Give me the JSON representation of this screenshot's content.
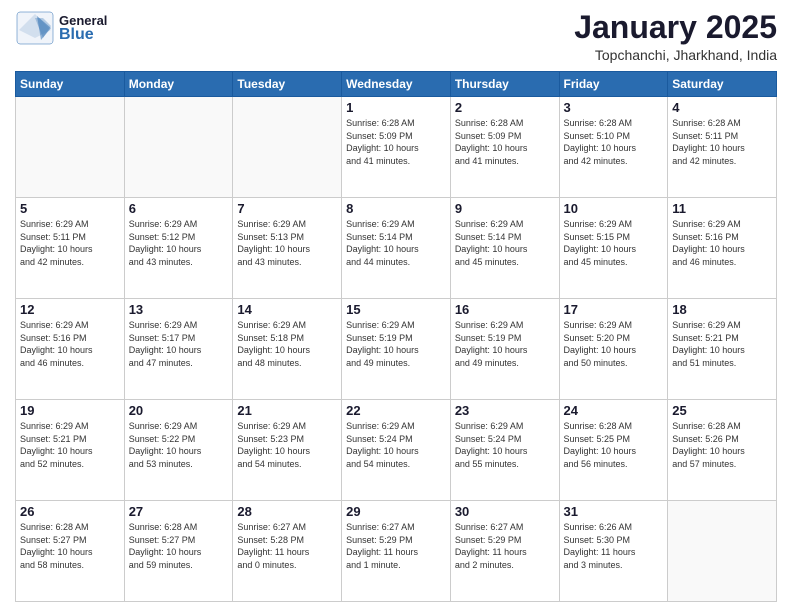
{
  "header": {
    "logo_general": "General",
    "logo_blue": "Blue",
    "month_title": "January 2025",
    "location": "Topchanchi, Jharkhand, India"
  },
  "days_of_week": [
    "Sunday",
    "Monday",
    "Tuesday",
    "Wednesday",
    "Thursday",
    "Friday",
    "Saturday"
  ],
  "weeks": [
    [
      {
        "day": "",
        "info": ""
      },
      {
        "day": "",
        "info": ""
      },
      {
        "day": "",
        "info": ""
      },
      {
        "day": "1",
        "info": "Sunrise: 6:28 AM\nSunset: 5:09 PM\nDaylight: 10 hours\nand 41 minutes."
      },
      {
        "day": "2",
        "info": "Sunrise: 6:28 AM\nSunset: 5:09 PM\nDaylight: 10 hours\nand 41 minutes."
      },
      {
        "day": "3",
        "info": "Sunrise: 6:28 AM\nSunset: 5:10 PM\nDaylight: 10 hours\nand 42 minutes."
      },
      {
        "day": "4",
        "info": "Sunrise: 6:28 AM\nSunset: 5:11 PM\nDaylight: 10 hours\nand 42 minutes."
      }
    ],
    [
      {
        "day": "5",
        "info": "Sunrise: 6:29 AM\nSunset: 5:11 PM\nDaylight: 10 hours\nand 42 minutes."
      },
      {
        "day": "6",
        "info": "Sunrise: 6:29 AM\nSunset: 5:12 PM\nDaylight: 10 hours\nand 43 minutes."
      },
      {
        "day": "7",
        "info": "Sunrise: 6:29 AM\nSunset: 5:13 PM\nDaylight: 10 hours\nand 43 minutes."
      },
      {
        "day": "8",
        "info": "Sunrise: 6:29 AM\nSunset: 5:14 PM\nDaylight: 10 hours\nand 44 minutes."
      },
      {
        "day": "9",
        "info": "Sunrise: 6:29 AM\nSunset: 5:14 PM\nDaylight: 10 hours\nand 45 minutes."
      },
      {
        "day": "10",
        "info": "Sunrise: 6:29 AM\nSunset: 5:15 PM\nDaylight: 10 hours\nand 45 minutes."
      },
      {
        "day": "11",
        "info": "Sunrise: 6:29 AM\nSunset: 5:16 PM\nDaylight: 10 hours\nand 46 minutes."
      }
    ],
    [
      {
        "day": "12",
        "info": "Sunrise: 6:29 AM\nSunset: 5:16 PM\nDaylight: 10 hours\nand 46 minutes."
      },
      {
        "day": "13",
        "info": "Sunrise: 6:29 AM\nSunset: 5:17 PM\nDaylight: 10 hours\nand 47 minutes."
      },
      {
        "day": "14",
        "info": "Sunrise: 6:29 AM\nSunset: 5:18 PM\nDaylight: 10 hours\nand 48 minutes."
      },
      {
        "day": "15",
        "info": "Sunrise: 6:29 AM\nSunset: 5:19 PM\nDaylight: 10 hours\nand 49 minutes."
      },
      {
        "day": "16",
        "info": "Sunrise: 6:29 AM\nSunset: 5:19 PM\nDaylight: 10 hours\nand 49 minutes."
      },
      {
        "day": "17",
        "info": "Sunrise: 6:29 AM\nSunset: 5:20 PM\nDaylight: 10 hours\nand 50 minutes."
      },
      {
        "day": "18",
        "info": "Sunrise: 6:29 AM\nSunset: 5:21 PM\nDaylight: 10 hours\nand 51 minutes."
      }
    ],
    [
      {
        "day": "19",
        "info": "Sunrise: 6:29 AM\nSunset: 5:21 PM\nDaylight: 10 hours\nand 52 minutes."
      },
      {
        "day": "20",
        "info": "Sunrise: 6:29 AM\nSunset: 5:22 PM\nDaylight: 10 hours\nand 53 minutes."
      },
      {
        "day": "21",
        "info": "Sunrise: 6:29 AM\nSunset: 5:23 PM\nDaylight: 10 hours\nand 54 minutes."
      },
      {
        "day": "22",
        "info": "Sunrise: 6:29 AM\nSunset: 5:24 PM\nDaylight: 10 hours\nand 54 minutes."
      },
      {
        "day": "23",
        "info": "Sunrise: 6:29 AM\nSunset: 5:24 PM\nDaylight: 10 hours\nand 55 minutes."
      },
      {
        "day": "24",
        "info": "Sunrise: 6:28 AM\nSunset: 5:25 PM\nDaylight: 10 hours\nand 56 minutes."
      },
      {
        "day": "25",
        "info": "Sunrise: 6:28 AM\nSunset: 5:26 PM\nDaylight: 10 hours\nand 57 minutes."
      }
    ],
    [
      {
        "day": "26",
        "info": "Sunrise: 6:28 AM\nSunset: 5:27 PM\nDaylight: 10 hours\nand 58 minutes."
      },
      {
        "day": "27",
        "info": "Sunrise: 6:28 AM\nSunset: 5:27 PM\nDaylight: 10 hours\nand 59 minutes."
      },
      {
        "day": "28",
        "info": "Sunrise: 6:27 AM\nSunset: 5:28 PM\nDaylight: 11 hours\nand 0 minutes."
      },
      {
        "day": "29",
        "info": "Sunrise: 6:27 AM\nSunset: 5:29 PM\nDaylight: 11 hours\nand 1 minute."
      },
      {
        "day": "30",
        "info": "Sunrise: 6:27 AM\nSunset: 5:29 PM\nDaylight: 11 hours\nand 2 minutes."
      },
      {
        "day": "31",
        "info": "Sunrise: 6:26 AM\nSunset: 5:30 PM\nDaylight: 11 hours\nand 3 minutes."
      },
      {
        "day": "",
        "info": ""
      }
    ]
  ]
}
